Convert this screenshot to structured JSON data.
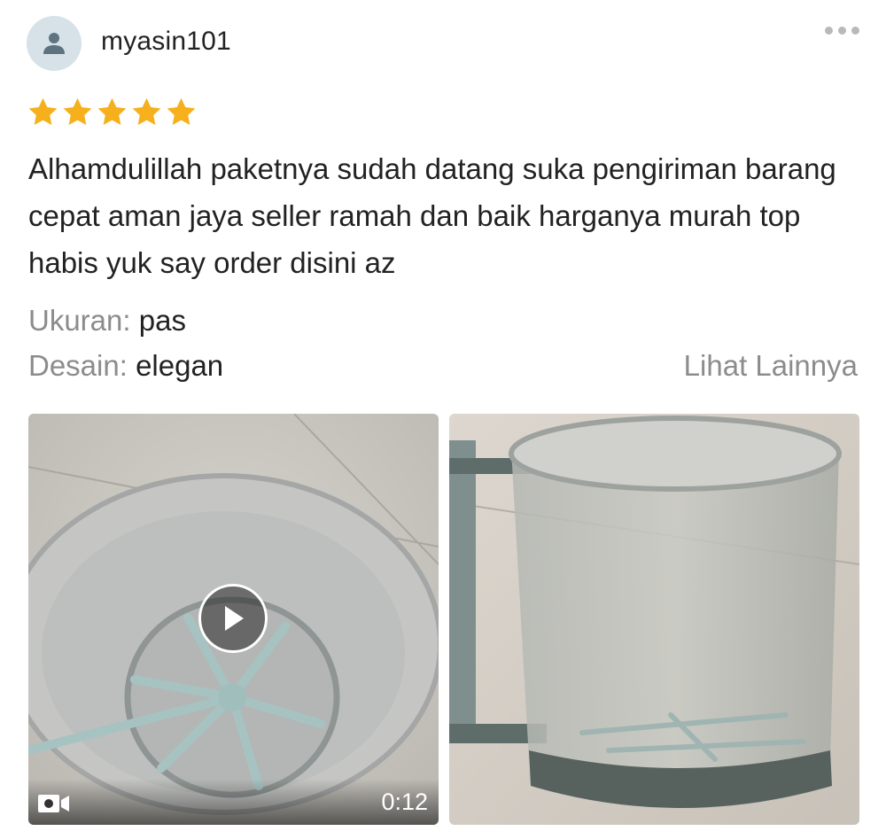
{
  "reviewer": {
    "username": "myasin101",
    "avatar_icon": "user-icon",
    "more_icon": "more-dots-icon"
  },
  "rating": {
    "stars": 5,
    "max": 5,
    "star_color": "#f5b01c"
  },
  "comment": "Alhamdulillah paketnya sudah datang suka pengiriman barang cepat aman jaya seller ramah dan baik harganya murah top habis yuk say order disini az",
  "attributes": [
    {
      "key": "Ukuran:",
      "value": "pas"
    },
    {
      "key": "Desain:",
      "value": "elegan"
    }
  ],
  "see_more_label": "Lihat Lainnya",
  "media": {
    "video": {
      "duration": "0:12",
      "play_icon": "play-icon",
      "video_icon": "video-camera-icon"
    },
    "photo": {
      "type": "image"
    }
  }
}
